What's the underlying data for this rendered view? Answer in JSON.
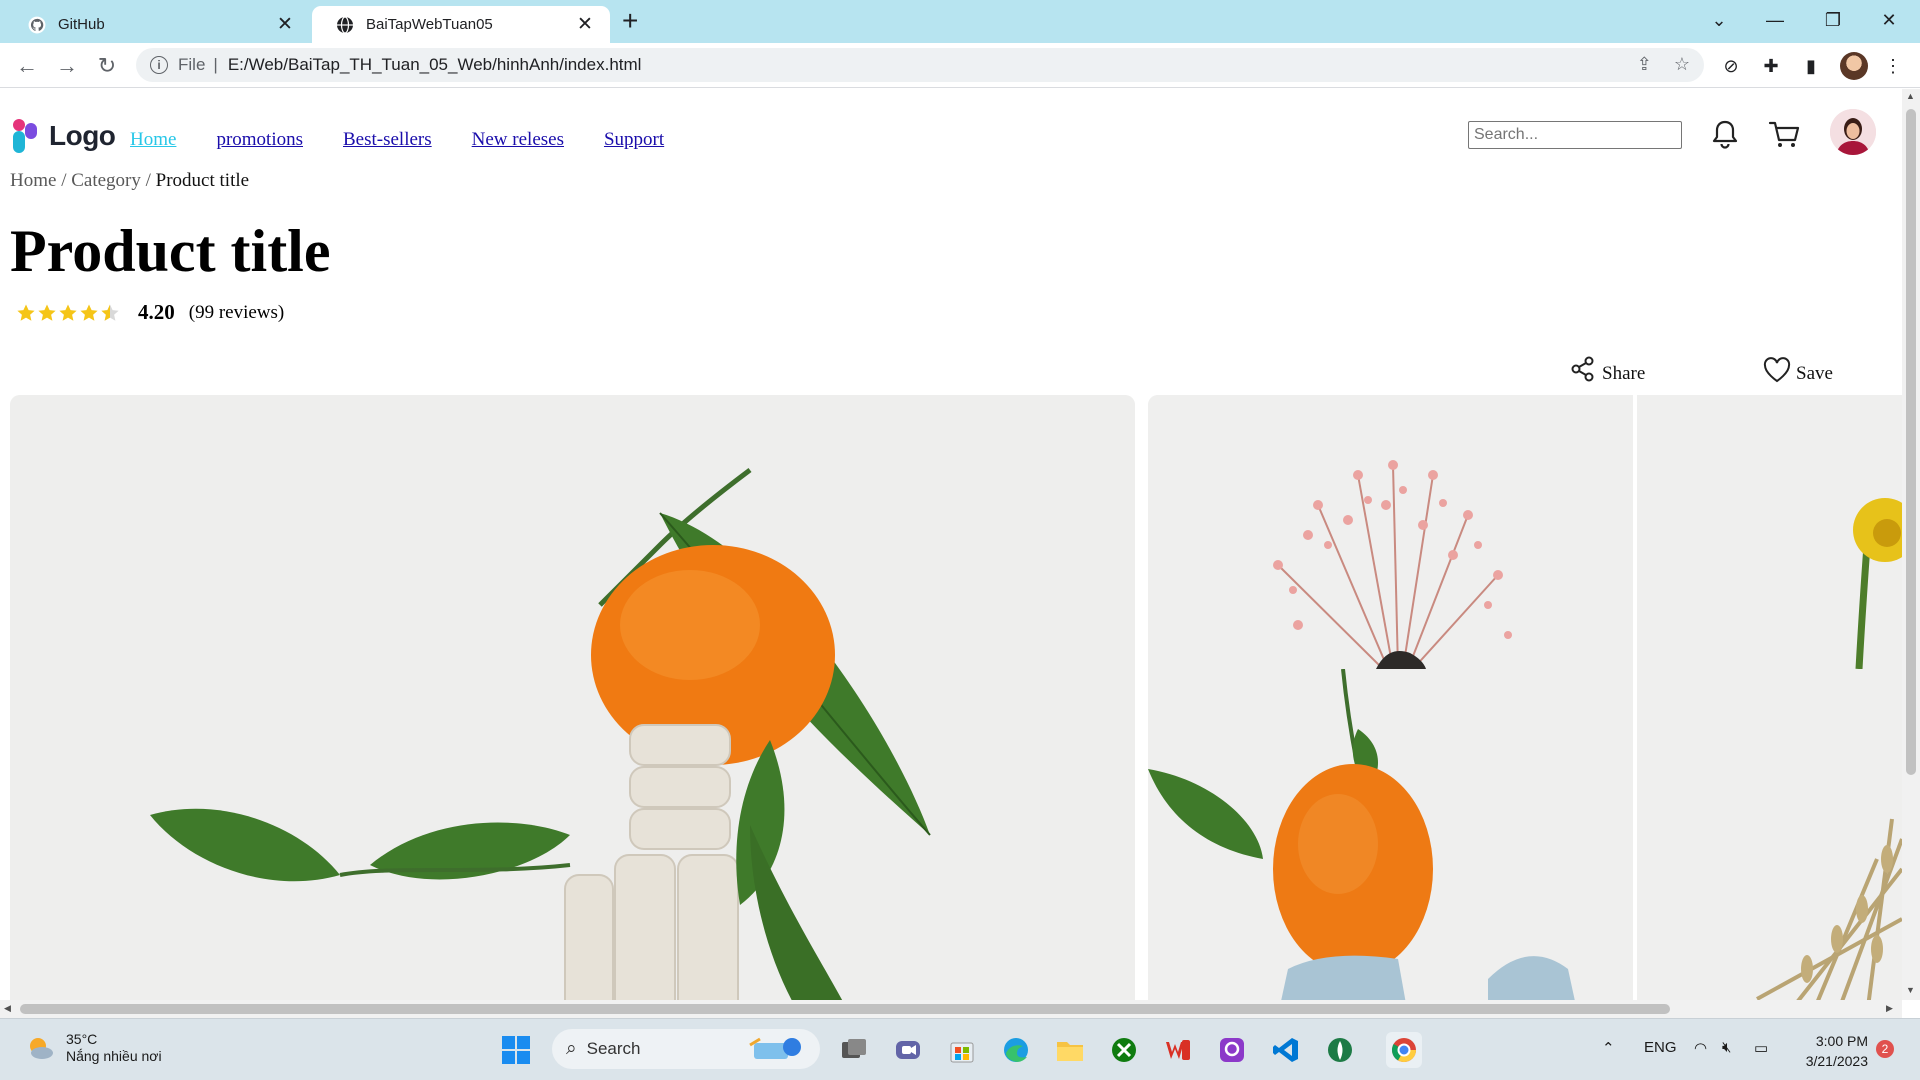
{
  "browser": {
    "tabs": [
      {
        "label": "GitHub",
        "active": false
      },
      {
        "label": "BaiTapWebTuan05",
        "active": true
      }
    ],
    "address": {
      "scheme": "File",
      "url": "E:/Web/BaiTap_TH_Tuan_05_Web/hinhAnh/index.html"
    }
  },
  "site": {
    "logo_text": "Logo",
    "nav": [
      {
        "label": "Home",
        "active": true
      },
      {
        "label": "promotions",
        "active": false
      },
      {
        "label": "Best-sellers",
        "active": false
      },
      {
        "label": "New releses",
        "active": false
      },
      {
        "label": "Support",
        "active": false
      }
    ],
    "search_placeholder": "Search...",
    "breadcrumb": [
      "Home",
      "Category",
      "Product title"
    ],
    "breadcrumb_sep": "/",
    "product_title": "Product title",
    "rating": {
      "value": "4.20",
      "stars": 4.2,
      "max": 5,
      "reviews_text": "(99 reviews)"
    },
    "actions": {
      "share": "Share",
      "save": "Save"
    },
    "colors": {
      "nav_link": "#1a0dab",
      "nav_active": "#27c7e8",
      "star": "#f5c518"
    }
  },
  "taskbar": {
    "weather": {
      "temp": "35°C",
      "desc": "Nắng nhiều nơi"
    },
    "search_label": "Search",
    "lang": "ENG",
    "time": "3:00 PM",
    "date": "3/21/2023",
    "notifications": "2"
  }
}
